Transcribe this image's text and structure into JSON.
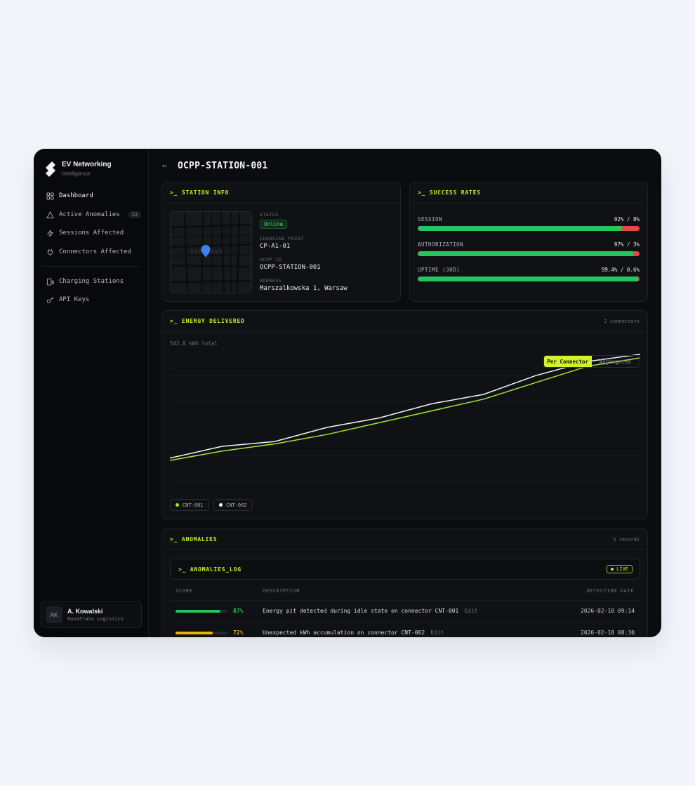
{
  "brand": {
    "name": "EV Networking",
    "subtitle": "Intelligence"
  },
  "sidebar": {
    "items": [
      {
        "label": "Dashboard",
        "icon": "grid-icon"
      },
      {
        "label": "Active Anomalies",
        "icon": "warning-icon",
        "badge": "12"
      },
      {
        "label": "Sessions Affected",
        "icon": "bolt-icon"
      },
      {
        "label": "Connectors Affected",
        "icon": "plug-icon"
      },
      {
        "label": "Charging Stations",
        "icon": "station-icon"
      },
      {
        "label": "API Keys",
        "icon": "key-icon"
      }
    ]
  },
  "user": {
    "initials": "AK",
    "name": "A. Kowalski",
    "org": "NovaTrans Logistics"
  },
  "header": {
    "back": "←",
    "title": "OCPP-STATION-001"
  },
  "station_info": {
    "title": ">_ STATION INFO",
    "map_label": "VARSZAWA",
    "status_label": "STATUS",
    "status": "Online",
    "charging_point_label": "CHARGING POINT",
    "charging_point": "CP-A1-01",
    "ocpp_id_label": "OCPP ID",
    "ocpp_id": "OCPP-STATION-001",
    "address_label": "ADDRESS",
    "address": "Marszalkowska 1, Warsaw"
  },
  "success_rates": {
    "title": ">_ SUCCESS RATES",
    "rows": [
      {
        "label": "SESSION",
        "value": "92% / 8%",
        "success": 92
      },
      {
        "label": "AUTHORIZATION",
        "value": "97% / 3%",
        "success": 97
      },
      {
        "label": "UPTIME (30D)",
        "value": "99.4% / 0.6%",
        "success": 99.4
      }
    ]
  },
  "energy": {
    "title": ">_ ENERGY DELIVERED",
    "meta": "2 connectors",
    "total": "542.8 kWh total",
    "toggle": {
      "per_connector": "Per Connector",
      "aggregated": "Aggregated"
    },
    "legend": [
      "CNT-001",
      "CNT-002"
    ]
  },
  "chart_data": {
    "type": "line",
    "x": [
      0,
      1,
      2,
      3,
      4,
      5,
      6,
      7,
      8,
      9
    ],
    "ylim": [
      0,
      100
    ],
    "series": [
      {
        "name": "CNT-001",
        "color": "#a3e635",
        "values": [
          16,
          24,
          30,
          38,
          48,
          58,
          68,
          82,
          96,
          103
        ]
      },
      {
        "name": "CNT-002",
        "color": "#f2f3f5",
        "values": [
          18,
          28,
          32,
          44,
          52,
          64,
          72,
          88,
          100,
          106
        ]
      }
    ]
  },
  "anomalies": {
    "title": ">_ ANOMALIES",
    "meta": "3 records",
    "log_title": ">_ ANOMALIES_LOG",
    "live": "LIVE",
    "columns": {
      "score": "SCORE",
      "description": "DESCRIPTION",
      "date": "DETECTION DATE"
    },
    "rows": [
      {
        "score": "87%",
        "score_value": 87,
        "color": "#22c55e",
        "description": "Energy pit detected during idle state on connector CNT-001",
        "edit": "Edit",
        "date": "2026-02-18 09:14"
      },
      {
        "score": "72%",
        "score_value": 72,
        "color": "#eab308",
        "description": "Unexpected kWh accumulation on connector CNT-002",
        "edit": "Edit",
        "date": "2026-02-18 08:30"
      }
    ]
  }
}
